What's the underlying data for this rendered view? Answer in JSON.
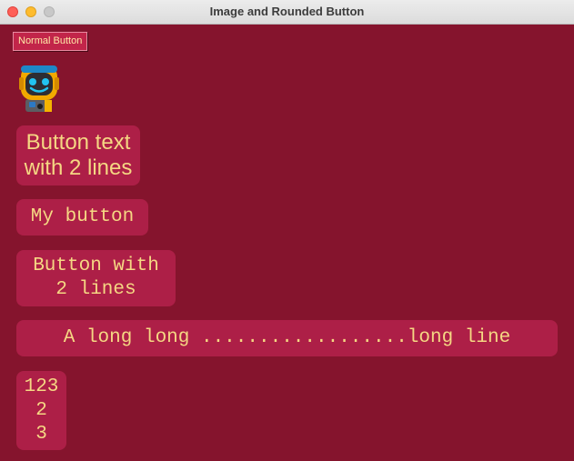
{
  "window": {
    "title": "Image and Rounded Button"
  },
  "colors": {
    "background": "#85142d",
    "button_fill": "#ad1f47",
    "button_text": "#f5d783",
    "normal_button_fill": "#c2254a"
  },
  "buttons": {
    "normal": "Normal Button",
    "image_icon": "robot-icon",
    "rounded": [
      "Button text\nwith 2 lines",
      "My button",
      "Button with\n2 lines",
      "A long long ..................long line",
      "123\n2\n3"
    ]
  }
}
